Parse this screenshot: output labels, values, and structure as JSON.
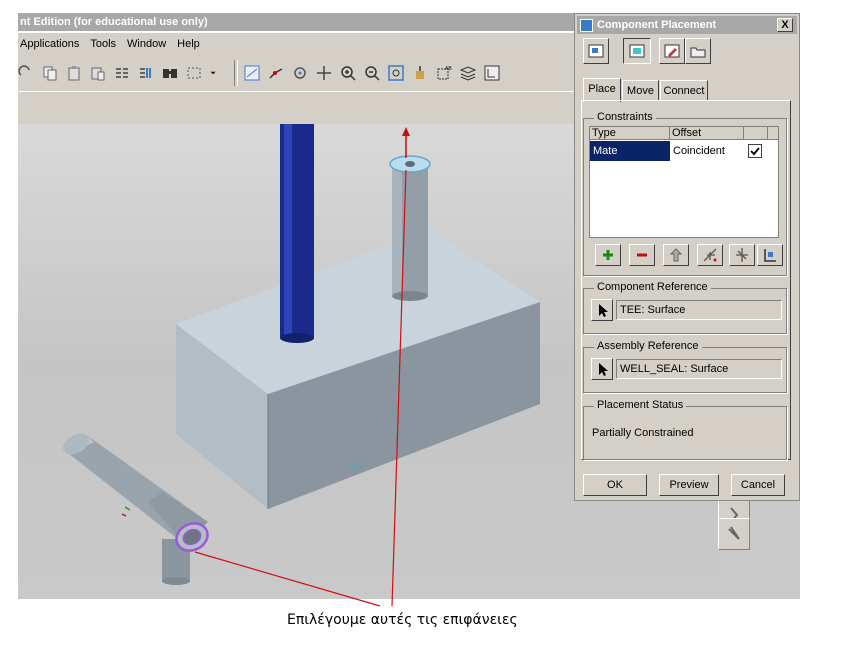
{
  "window": {
    "title": "nt Edition (for educational use only)"
  },
  "menu": {
    "items": [
      "Applications",
      "Tools",
      "Window",
      "Help"
    ]
  },
  "toolbar": {
    "icons": [
      "redo-icon",
      "copy-icon",
      "paste-icon",
      "paste-special-icon",
      "mirror-icon",
      "merge-icon",
      "find-icon",
      "select-box-icon",
      "dropdown-arrow-icon",
      "datum-display-icon",
      "axis-icon",
      "spin-center-icon",
      "pan-icon",
      "zoom-in-icon",
      "zoom-out-icon",
      "refit-icon",
      "orient-icon",
      "annotation-icon",
      "layers-icon",
      "model-tree-icon"
    ]
  },
  "dialog": {
    "title": "Component Placement",
    "close_label": "X",
    "tabs": [
      "Place",
      "Move",
      "Connect"
    ],
    "constraints": {
      "label": "Constraints",
      "columns": [
        "Type",
        "Offset"
      ],
      "rows": [
        {
          "type": "Mate",
          "offset": "Coincident",
          "checked": true
        }
      ]
    },
    "component_reference": {
      "label": "Component Reference",
      "value": "TEE: Surface"
    },
    "assembly_reference": {
      "label": "Assembly Reference",
      "value": "WELL_SEAL: Surface"
    },
    "placement_status": {
      "label": "Placement Status",
      "value": "Partially Constrained"
    },
    "buttons": {
      "ok": "OK",
      "preview": "Preview",
      "cancel": "Cancel"
    }
  },
  "caption": "Επιλέγουμε αυτές τις επιφάνειες",
  "colors": {
    "block": "#b8c3cc",
    "rod": "#1c2a8c",
    "pipe": "#9aa4ad",
    "highlight": "#9b59d6",
    "leader": "#d01010",
    "selected_row": "#0a246a"
  }
}
